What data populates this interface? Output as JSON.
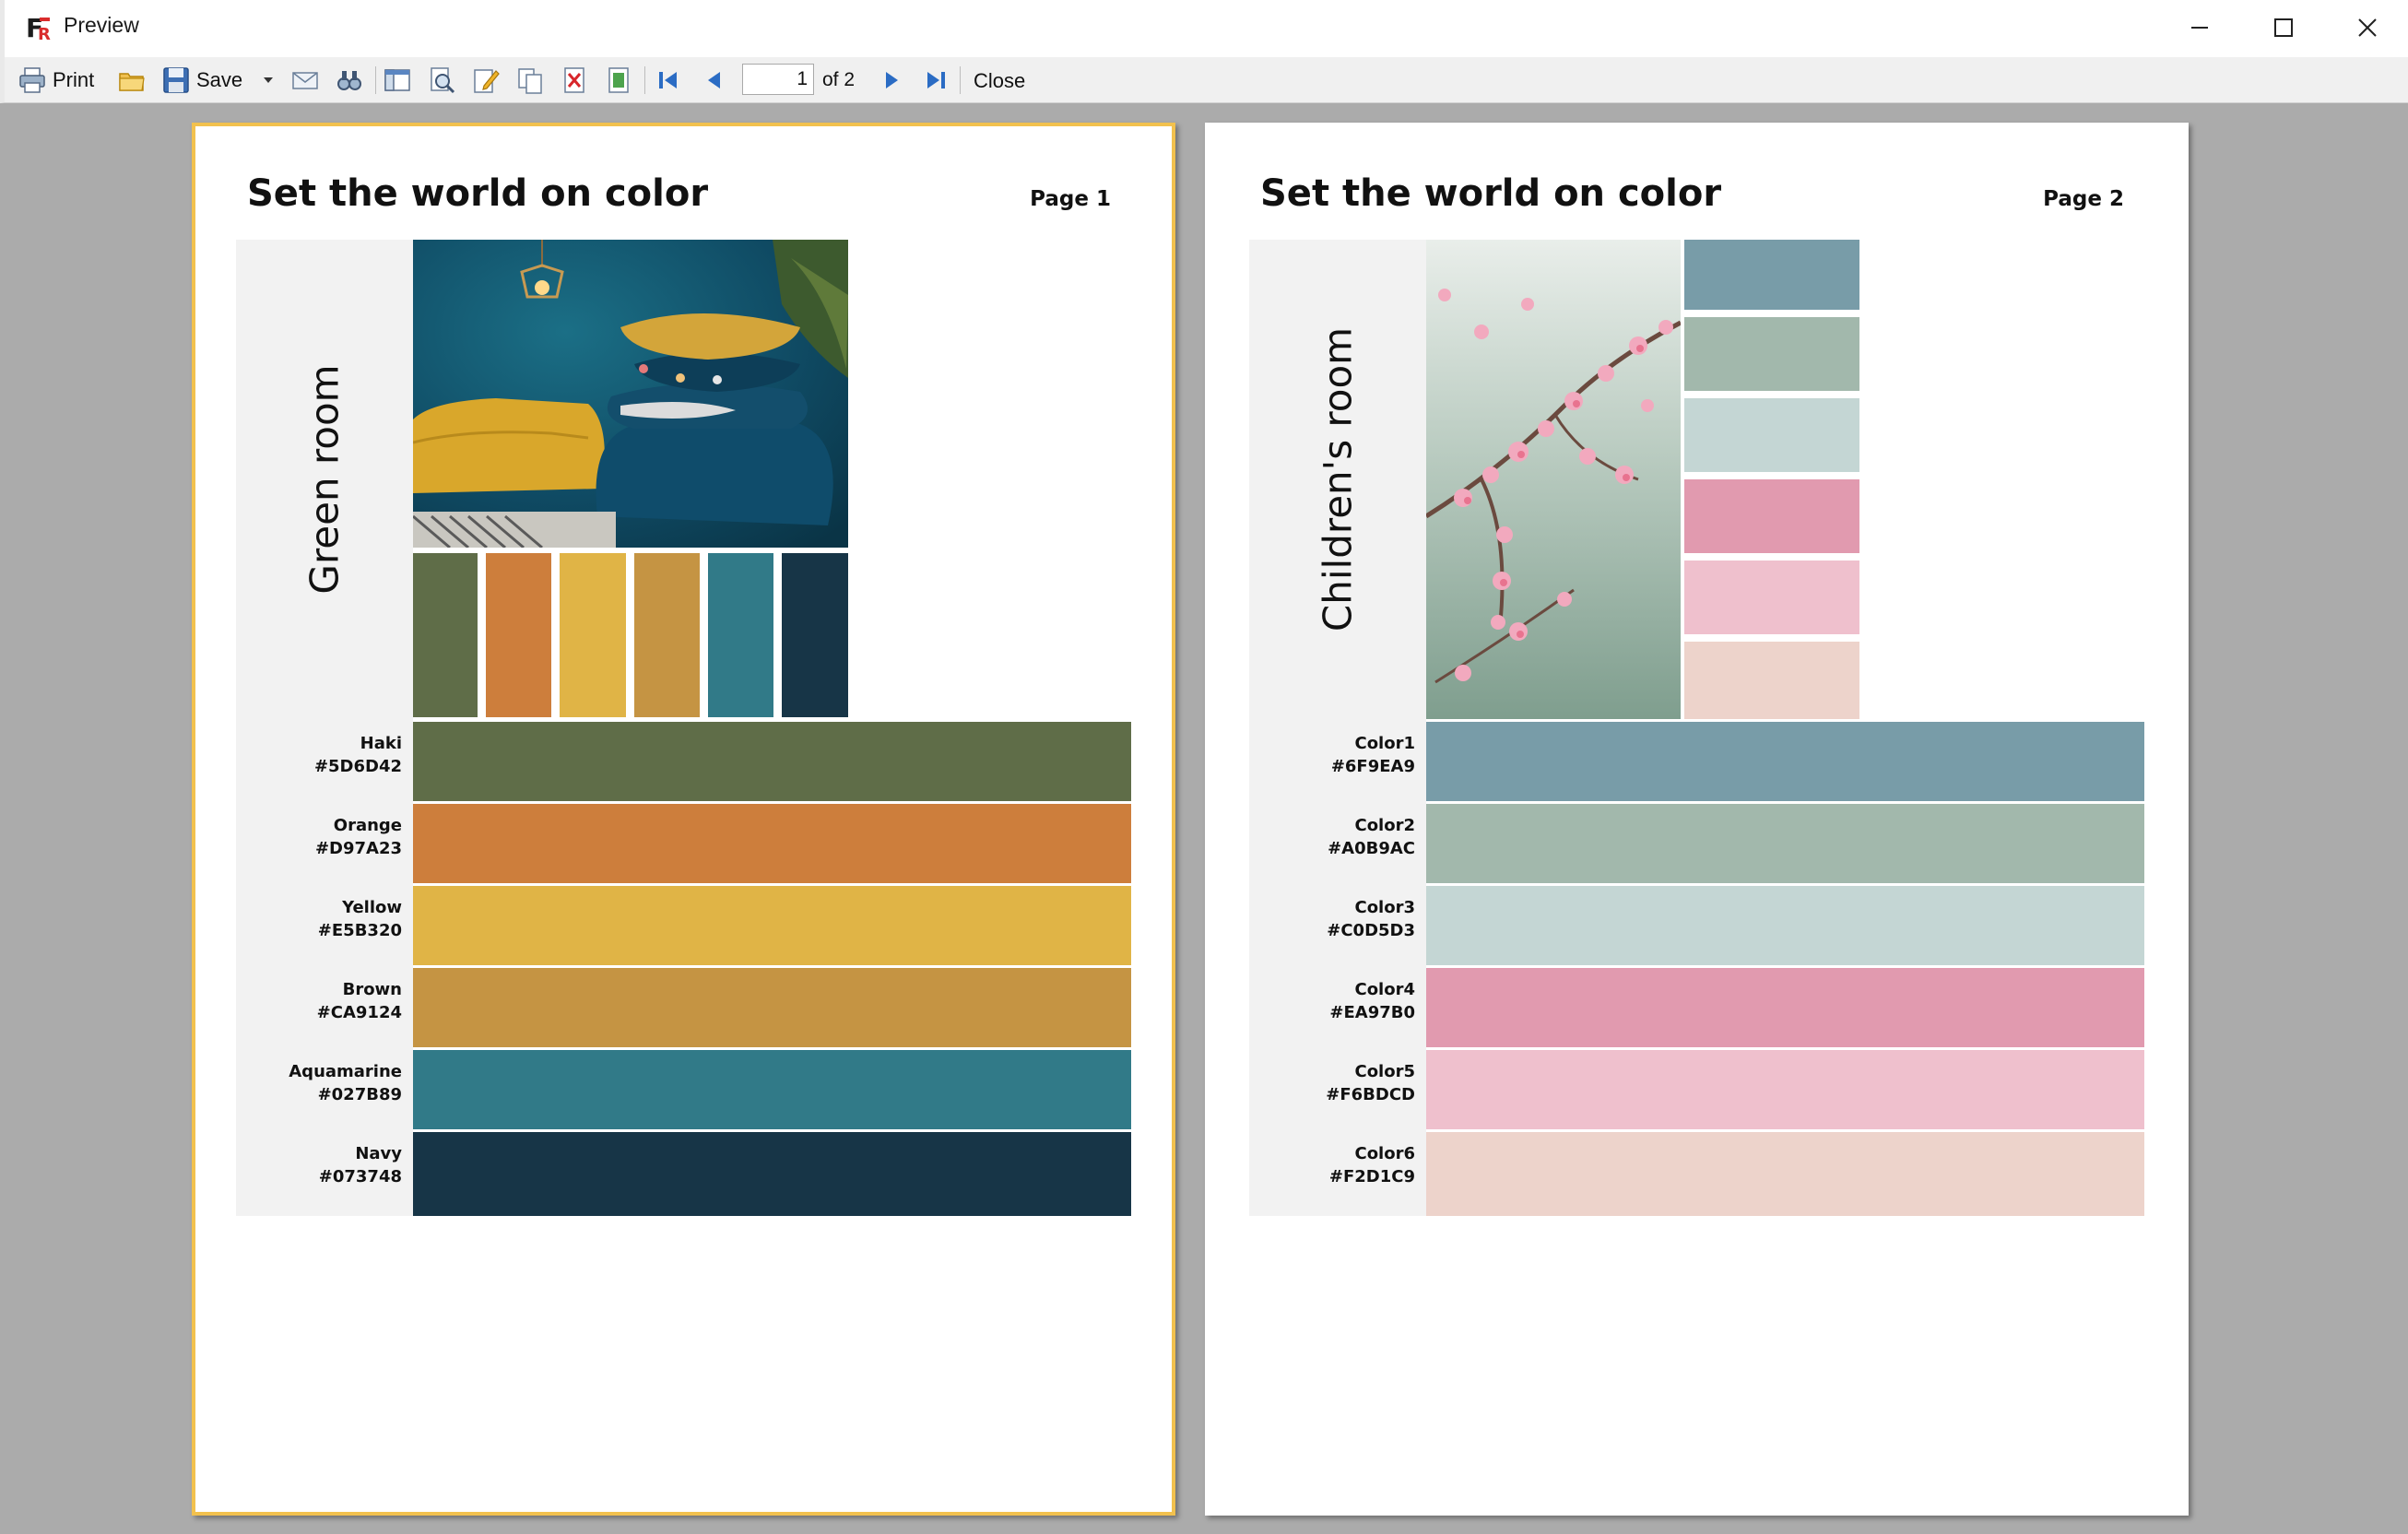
{
  "window": {
    "title": "Preview",
    "icons": [
      "app-logo-icon",
      "minimize-icon",
      "maximize-icon",
      "close-window-icon"
    ]
  },
  "toolbar": {
    "print_label": "Print",
    "save_label": "Save",
    "page_value": "1",
    "of_label": "of 2",
    "close_label": "Close",
    "icons": [
      "printer-icon",
      "open-folder-icon",
      "floppy-icon",
      "dropdown-arrow-icon",
      "email-icon",
      "find-icon",
      "outline-icon",
      "zoom-icon",
      "edit-icon",
      "copy-page-icon",
      "delete-page-icon",
      "page-setup-icon",
      "first-page-icon",
      "prev-page-icon",
      "next-page-icon",
      "last-page-icon"
    ]
  },
  "pages": [
    {
      "title": "Set the world on color",
      "page_label": "Page 1",
      "room": "Green room",
      "photo": "blue-room-poufs-photo",
      "colors": [
        {
          "name": "Haki",
          "hex": "#5D6D42"
        },
        {
          "name": "Orange",
          "hex": "#D97A23"
        },
        {
          "name": "Yellow",
          "hex": "#E5B320"
        },
        {
          "name": "Brown",
          "hex": "#CA9124"
        },
        {
          "name": "Aquamarine",
          "hex": "#027B89"
        },
        {
          "name": "Navy",
          "hex": "#073748"
        }
      ]
    },
    {
      "title": "Set the world on color",
      "page_label": "Page 2",
      "room": "Children's room",
      "photo": "cherry-blossom-photo",
      "colors": [
        {
          "name": "Color1",
          "hex": "#6F9EA9"
        },
        {
          "name": "Color2",
          "hex": "#A0B9AC"
        },
        {
          "name": "Color3",
          "hex": "#C0D5D3"
        },
        {
          "name": "Color4",
          "hex": "#EA97B0"
        },
        {
          "name": "Color5",
          "hex": "#F6BDCD"
        },
        {
          "name": "Color6",
          "hex": "#F2D1C9"
        }
      ]
    }
  ],
  "render_colors": {
    "page1": [
      "#5F6D48",
      "#CD7E3C",
      "#E0B446",
      "#C59443",
      "#317A88",
      "#173547"
    ],
    "page2": [
      "#789CA8",
      "#A2B8AC",
      "#C4D6D4",
      "#E19AAF",
      "#EFC0CD",
      "#EDD3CB"
    ]
  }
}
